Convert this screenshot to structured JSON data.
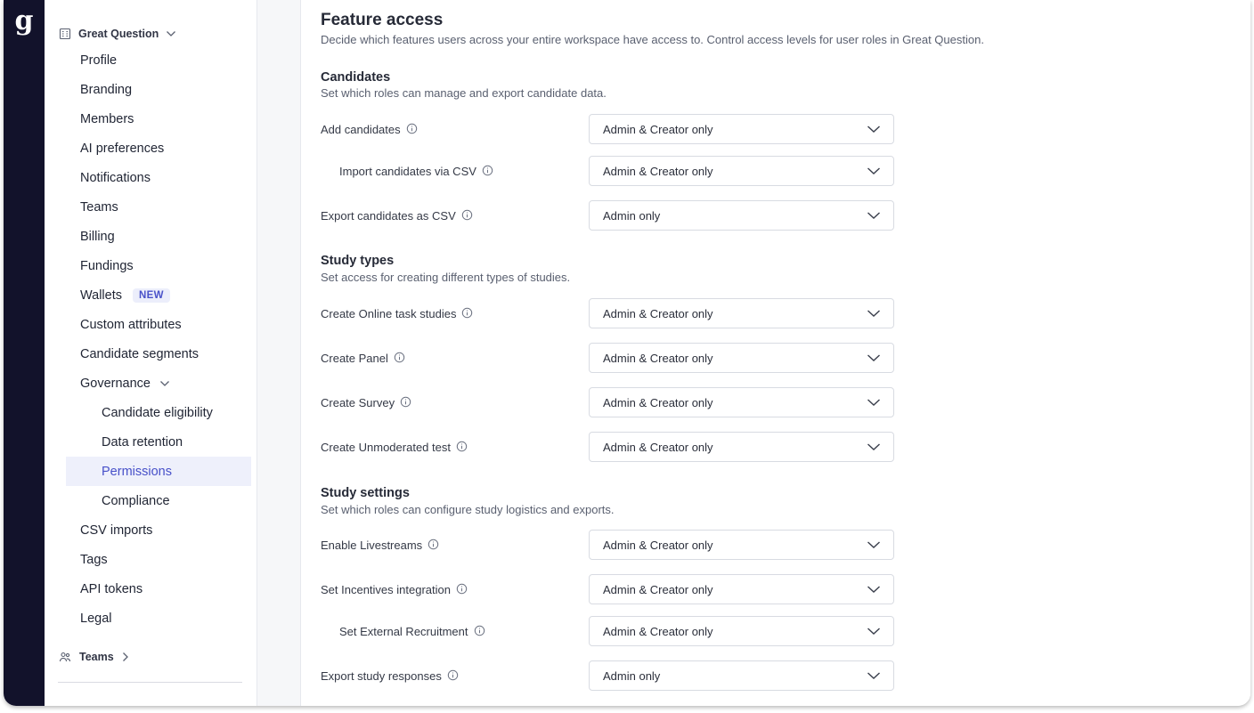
{
  "app": {
    "logo_letter": "g",
    "rail_color": "#12122b",
    "accent": "#4750c9"
  },
  "sidebar": {
    "workspace_name": "Great Question",
    "items": [
      {
        "label": "Profile",
        "level": 1
      },
      {
        "label": "Branding",
        "level": 1
      },
      {
        "label": "Members",
        "level": 1
      },
      {
        "label": "AI preferences",
        "level": 1
      },
      {
        "label": "Notifications",
        "level": 1
      },
      {
        "label": "Teams",
        "level": 1
      },
      {
        "label": "Billing",
        "level": 1
      },
      {
        "label": "Fundings",
        "level": 1
      },
      {
        "label": "Wallets",
        "level": 1,
        "badge": "NEW"
      },
      {
        "label": "Custom attributes",
        "level": 1
      },
      {
        "label": "Candidate segments",
        "level": 1
      },
      {
        "label": "Governance",
        "level": 1,
        "expanded": true
      },
      {
        "label": "Candidate eligibility",
        "level": 2
      },
      {
        "label": "Data retention",
        "level": 2
      },
      {
        "label": "Permissions",
        "level": 2,
        "active": true
      },
      {
        "label": "Compliance",
        "level": 2
      },
      {
        "label": "CSV imports",
        "level": 1
      },
      {
        "label": "Tags",
        "level": 1
      },
      {
        "label": "API tokens",
        "level": 1
      },
      {
        "label": "Legal",
        "level": 1
      }
    ],
    "teams_footer": "Teams"
  },
  "main": {
    "title": "Feature access",
    "description": "Decide which features users across your entire workspace have access to. Control access levels for user roles in Great Question.",
    "sections": [
      {
        "title": "Candidates",
        "description": "Set which roles can manage and export candidate data.",
        "rows": [
          {
            "label": "Add candidates",
            "value": "Admin & Creator only",
            "indent": false
          },
          {
            "label": "Import candidates via CSV",
            "value": "Admin & Creator only",
            "indent": true
          },
          {
            "label": "Export candidates as CSV",
            "value": "Admin only",
            "indent": false
          }
        ]
      },
      {
        "title": "Study types",
        "description": "Set access for creating different types of studies.",
        "rows": [
          {
            "label": "Create Online task studies",
            "value": "Admin & Creator only",
            "indent": false
          },
          {
            "label": "Create Panel",
            "value": "Admin & Creator only",
            "indent": false
          },
          {
            "label": "Create Survey",
            "value": "Admin & Creator only",
            "indent": false
          },
          {
            "label": "Create Unmoderated test",
            "value": "Admin & Creator only",
            "indent": false
          }
        ]
      },
      {
        "title": "Study settings",
        "description": "Set which roles can configure study logistics and exports.",
        "rows": [
          {
            "label": "Enable Livestreams",
            "value": "Admin & Creator only",
            "indent": false
          },
          {
            "label": "Set Incentives integration",
            "value": "Admin & Creator only",
            "indent": false
          },
          {
            "label": "Set External Recruitment",
            "value": "Admin & Creator only",
            "indent": true
          },
          {
            "label": "Export study responses",
            "value": "Admin only",
            "indent": false
          }
        ]
      }
    ]
  }
}
